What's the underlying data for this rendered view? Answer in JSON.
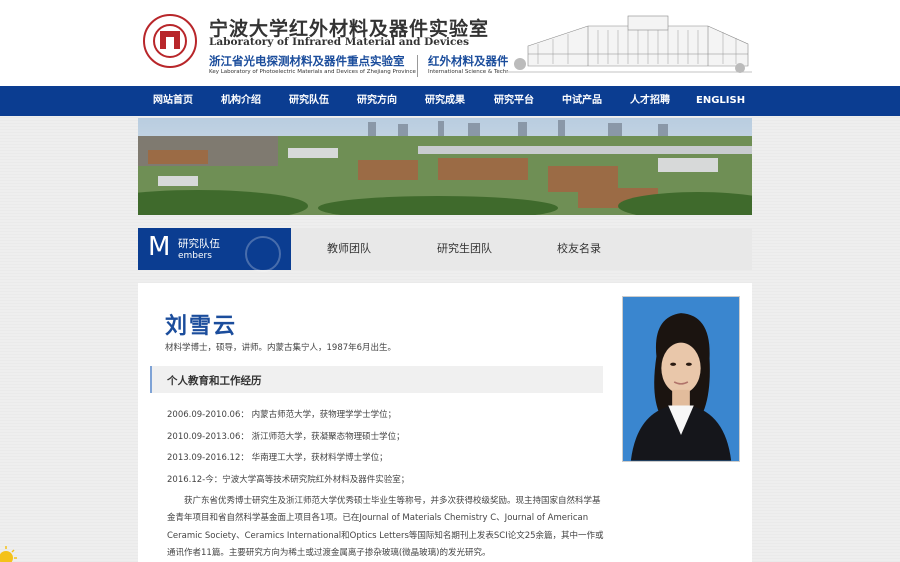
{
  "header": {
    "title_cn": "宁波大学红外材料及器件实验室",
    "title_en": "Laboratory of Infrared Material and Devices",
    "sub_left_cn": "浙江省光电探测材料及器件重点实验室",
    "sub_left_en": "Key Laboratory of Photoelectric Materials and Devices of Zhejiang Province",
    "sub_right_cn": "红外材料及器件研究浙江国际科技合作基地",
    "sub_right_en": "International Science & Technology Cooperation Base of  Infrared Materials and Devices (Zhejiang  Province)"
  },
  "nav": {
    "items": [
      "网站首页",
      "机构介绍",
      "研究队伍",
      "研究方向",
      "研究成果",
      "研究平台",
      "中试产品",
      "人才招聘",
      "ENGLISH"
    ]
  },
  "section": {
    "letter": "M",
    "title_cn": "研究队伍",
    "title_en": "embers"
  },
  "subnav": {
    "items": [
      "教师团队",
      "研究生团队",
      "校友名录"
    ]
  },
  "profile": {
    "name": "刘雪云",
    "intro": "材料学博士，硕导，讲师。内蒙古集宁人，1987年6月出生。",
    "section_heading": "个人教育和工作经历",
    "timeline": [
      "2006.09-2010.06： 内蒙古师范大学，获物理学学士学位；",
      "2010.09-2013.06： 浙江师范大学，获凝聚态物理硕士学位；",
      "2013.09-2016.12： 华南理工大学，获材料学博士学位；",
      "2016.12-今：宁波大学高等技术研究院红外材料及器件实验室；"
    ],
    "bio": "获广东省优秀博士研究生及浙江师范大学优秀硕士毕业生等称号，并多次获得校级奖励。现主持国家自然科学基金青年项目和省自然科学基金面上项目各1项。已在Journal of Materials Chemistry C、Journal of American Ceramic Society、Ceramics International和Optics Letters等国际知名期刊上发表SCI论文25余篇，其中一作或通讯作者11篇。主要研究方向为稀土或过渡金属离子掺杂玻璃(微晶玻璃)的发光研究。"
  },
  "colors": {
    "nav_bg": "#0b3d91",
    "brand_red": "#b8262a",
    "name_blue": "#1b4d9c"
  }
}
